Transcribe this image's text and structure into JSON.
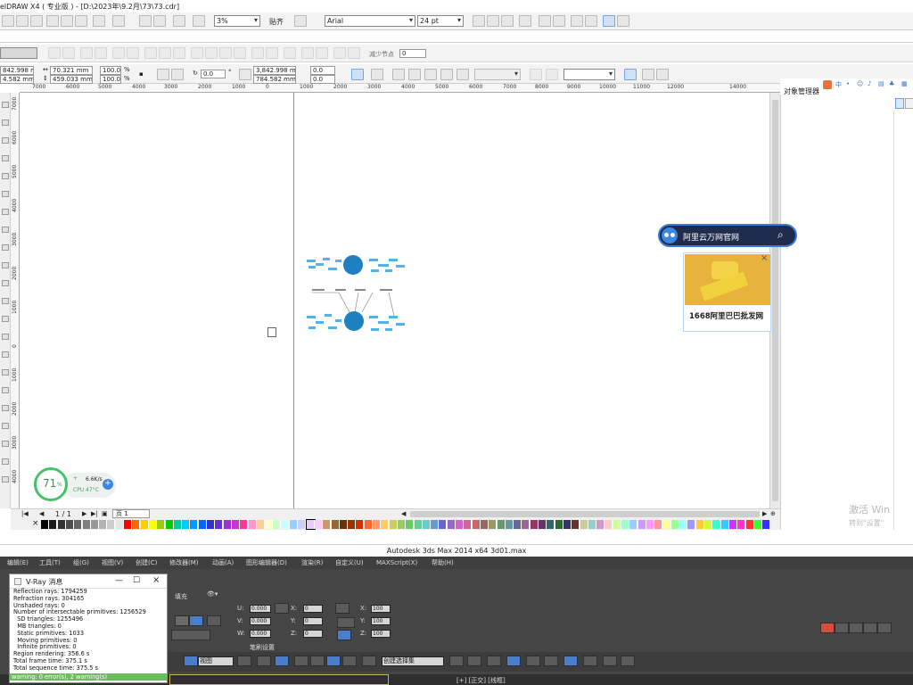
{
  "corel": {
    "window_title": "elDRAW X4 ( 专业版 ) - [D:\\2023年\\9.2月\\73\\73.cdr]",
    "std_toolbar": {
      "zoom_value": "3%",
      "snap_label": "贴齐",
      "font_name": "Arial",
      "font_size": "24 pt"
    },
    "node_toolbar": {
      "reduce_nodes_label": "减少节点",
      "reduce_nodes_value": "0"
    },
    "properties": {
      "x": "842.998 mm",
      "y": "4.582 mm",
      "width": "70.321 mm",
      "height": "459.033 mm",
      "scale_w": "100.0",
      "scale_h": "100.0",
      "percent_symbol": "%",
      "rotation": "0.0",
      "degree_symbol": "°",
      "pos_x": "3,842.998 mm",
      "pos_y": "784.582 mm",
      "skew_h": "0.0",
      "skew_v": "0.0"
    },
    "ruler_h": [
      "7000",
      "6000",
      "5000",
      "4000",
      "3000",
      "2000",
      "1000",
      "0",
      "1000",
      "2000",
      "3000",
      "4000",
      "5000",
      "6000",
      "7000",
      "8000",
      "9000",
      "10000",
      "11000",
      "12000",
      "14000"
    ],
    "ruler_v": [
      "7000",
      "6000",
      "5000",
      "4000",
      "3000",
      "2000",
      "1000",
      "0",
      "1000",
      "2000",
      "3000",
      "4000"
    ],
    "page_nav": {
      "counter": "1 / 1",
      "page_tab": "页 1"
    },
    "docker_title": "对象管理器",
    "palette_colors": [
      "#000000",
      "#1a1a1a",
      "#333333",
      "#4d4d4d",
      "#666666",
      "#808080",
      "#999999",
      "#b3b3b3",
      "#cccccc",
      "#e6e6e6",
      "#ff0000",
      "#ff6600",
      "#ffcc00",
      "#ffff00",
      "#99cc00",
      "#00cc00",
      "#00cc99",
      "#00ccff",
      "#0099ff",
      "#0066ff",
      "#3333cc",
      "#6633cc",
      "#9933cc",
      "#cc33cc",
      "#ff3399",
      "#ff99cc",
      "#ffcc99",
      "#ffffcc",
      "#ccffcc",
      "#ccffff",
      "#99ccff",
      "#ccccff",
      "#e6ccff",
      "#ffccff",
      "#cc9966",
      "#996633",
      "#663300",
      "#993300",
      "#cc3300",
      "#ff6633",
      "#ff9966",
      "#ffcc66",
      "#cccc66",
      "#99cc66",
      "#66cc66",
      "#66cc99",
      "#66cccc",
      "#6699cc",
      "#6666cc",
      "#9966cc",
      "#cc66cc",
      "#cc6699",
      "#cc6666",
      "#996666",
      "#999966",
      "#669966",
      "#669999",
      "#666699",
      "#996699",
      "#993366",
      "#663366",
      "#336666",
      "#336633",
      "#333366",
      "#663333",
      "#cccc99",
      "#99cccc",
      "#cc99cc",
      "#ffcccc",
      "#ccff99",
      "#99ffcc",
      "#99ccff",
      "#cc99ff",
      "#ff99ff",
      "#ff9999",
      "#ffff99",
      "#99ff99",
      "#99ffff",
      "#9999ff",
      "#ffcc33",
      "#ccff33",
      "#33ffcc",
      "#33ccff",
      "#cc33ff",
      "#ff33cc",
      "#ff3333",
      "#33ff33",
      "#3333ff"
    ],
    "active_swatch_index": 32
  },
  "search_widget": {
    "label": "阿里云万网官网"
  },
  "ad_card": {
    "caption": "1668阿里巴巴批发网",
    "close": "×"
  },
  "status_widget": {
    "percent": "71",
    "percent_unit": "%",
    "net_speed": "6.6K/s",
    "cpu_label": "CPU",
    "cpu_temp": "47°C",
    "plus": "+"
  },
  "max": {
    "title": "Autodesk 3ds Max  2014 x64      3d01.max",
    "menu": [
      "编辑(E)",
      "工具(T)",
      "组(G)",
      "视图(V)",
      "创建(C)",
      "修改器(M)",
      "动画(A)",
      "图形编辑器(D)",
      "渲染(R)",
      "自定义(U)",
      "MAXScript(X)",
      "帮助(H)"
    ],
    "fill_label": "填充",
    "coords": {
      "u": "0.000",
      "v": "0.000",
      "w": "0.000",
      "x": "0",
      "y": "0",
      "z": "0",
      "sx": "100",
      "sy": "100",
      "sz": "100"
    },
    "pen_settings": "笔刷设置",
    "view_dropdown": "视图",
    "selection_set_placeholder": "创建选择集",
    "viewport_label": "[+] [正交] [线框]"
  },
  "vray": {
    "title": "V-Ray 消息",
    "lines": [
      "Reflection rays: 1794259",
      "Refraction rays: 304165",
      "Unshaded rays: 0",
      "Number of intersectable primitives: 1256529",
      "  SD triangles: 1255496",
      "  MB triangles: 0",
      "  Static primitives: 1033",
      "  Moving primitives: 0",
      "  Infinite primitives: 0",
      "Region rendering: 356.6 s",
      "Total frame time: 375.1 s",
      "Total sequence time: 375.5 s"
    ],
    "warning": "warning: 0 error(s), 2 warning(s)"
  },
  "activation": {
    "main": "激活 Win",
    "sub": "转到\"设置\""
  }
}
